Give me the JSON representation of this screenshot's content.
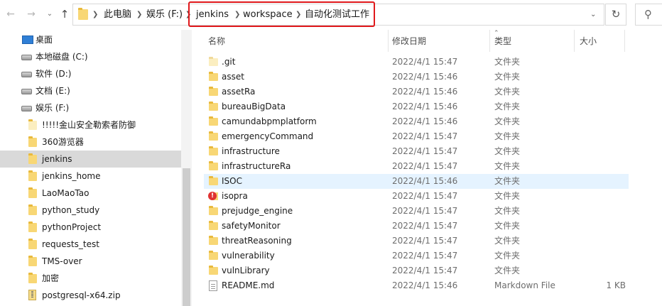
{
  "address_bar": {
    "breadcrumbs": [
      {
        "label": "此电脑"
      },
      {
        "label": "娱乐 (F:)"
      },
      {
        "label": "jenkins"
      },
      {
        "label": "workspace"
      },
      {
        "label": "自动化测试工作"
      }
    ],
    "highlight_color": "#e0181b"
  },
  "nav_pane": {
    "items": [
      {
        "label": "桌面",
        "icon": "desktop-icon",
        "indent": 1
      },
      {
        "label": "本地磁盘 (C:)",
        "icon": "drive-icon",
        "indent": 1
      },
      {
        "label": "软件 (D:)",
        "icon": "drive-icon",
        "indent": 1
      },
      {
        "label": "文档 (E:)",
        "icon": "drive-icon",
        "indent": 1
      },
      {
        "label": "娱乐 (F:)",
        "icon": "drive-icon",
        "indent": 1
      },
      {
        "label": "!!!!!金山安全勒索者防御",
        "icon": "folder-icon",
        "indent": 2
      },
      {
        "label": "360游览器",
        "icon": "folder-icon",
        "indent": 2
      },
      {
        "label": "jenkins",
        "icon": "folder-icon",
        "indent": 2,
        "selected": true
      },
      {
        "label": "jenkins_home",
        "icon": "folder-icon",
        "indent": 2
      },
      {
        "label": "LaoMaoTao",
        "icon": "folder-icon",
        "indent": 2
      },
      {
        "label": "python_study",
        "icon": "folder-icon",
        "indent": 2
      },
      {
        "label": "pythonProject",
        "icon": "folder-icon",
        "indent": 2
      },
      {
        "label": "requests_test",
        "icon": "folder-icon",
        "indent": 2
      },
      {
        "label": "TMS-over",
        "icon": "folder-icon",
        "indent": 2
      },
      {
        "label": "加密",
        "icon": "folder-icon",
        "indent": 2
      },
      {
        "label": "postgresql-x64.zip",
        "icon": "zip-icon",
        "indent": 2
      }
    ]
  },
  "columns": {
    "name": "名称",
    "date": "修改日期",
    "type": "类型",
    "size": "大小"
  },
  "files": [
    {
      "name": ".git",
      "date": "2022/4/1 15:47",
      "type": "文件夹",
      "size": "",
      "icon": "folder-icon",
      "faded": true
    },
    {
      "name": "asset",
      "date": "2022/4/1 15:46",
      "type": "文件夹",
      "size": "",
      "icon": "folder-icon"
    },
    {
      "name": "assetRa",
      "date": "2022/4/1 15:46",
      "type": "文件夹",
      "size": "",
      "icon": "folder-icon"
    },
    {
      "name": "bureauBigData",
      "date": "2022/4/1 15:46",
      "type": "文件夹",
      "size": "",
      "icon": "folder-icon"
    },
    {
      "name": "camundabpmplatform",
      "date": "2022/4/1 15:46",
      "type": "文件夹",
      "size": "",
      "icon": "folder-icon"
    },
    {
      "name": "emergencyCommand",
      "date": "2022/4/1 15:47",
      "type": "文件夹",
      "size": "",
      "icon": "folder-icon"
    },
    {
      "name": "infrastructure",
      "date": "2022/4/1 15:47",
      "type": "文件夹",
      "size": "",
      "icon": "folder-icon"
    },
    {
      "name": "infrastructureRa",
      "date": "2022/4/1 15:47",
      "type": "文件夹",
      "size": "",
      "icon": "folder-icon"
    },
    {
      "name": "ISOC",
      "date": "2022/4/1 15:46",
      "type": "文件夹",
      "size": "",
      "icon": "folder-icon",
      "hover": true
    },
    {
      "name": "isopra",
      "date": "2022/4/1 15:47",
      "type": "文件夹",
      "size": "",
      "icon": "alert-folder-icon"
    },
    {
      "name": "prejudge_engine",
      "date": "2022/4/1 15:47",
      "type": "文件夹",
      "size": "",
      "icon": "folder-icon"
    },
    {
      "name": "safetyMonitor",
      "date": "2022/4/1 15:47",
      "type": "文件夹",
      "size": "",
      "icon": "folder-icon"
    },
    {
      "name": "threatReasoning",
      "date": "2022/4/1 15:47",
      "type": "文件夹",
      "size": "",
      "icon": "folder-icon"
    },
    {
      "name": "vulnerability",
      "date": "2022/4/1 15:47",
      "type": "文件夹",
      "size": "",
      "icon": "folder-icon"
    },
    {
      "name": "vulnLibrary",
      "date": "2022/4/1 15:47",
      "type": "文件夹",
      "size": "",
      "icon": "folder-icon"
    },
    {
      "name": "README.md",
      "date": "2022/4/1 15:46",
      "type": "Markdown File",
      "size": "1 KB",
      "icon": "document-icon"
    }
  ]
}
